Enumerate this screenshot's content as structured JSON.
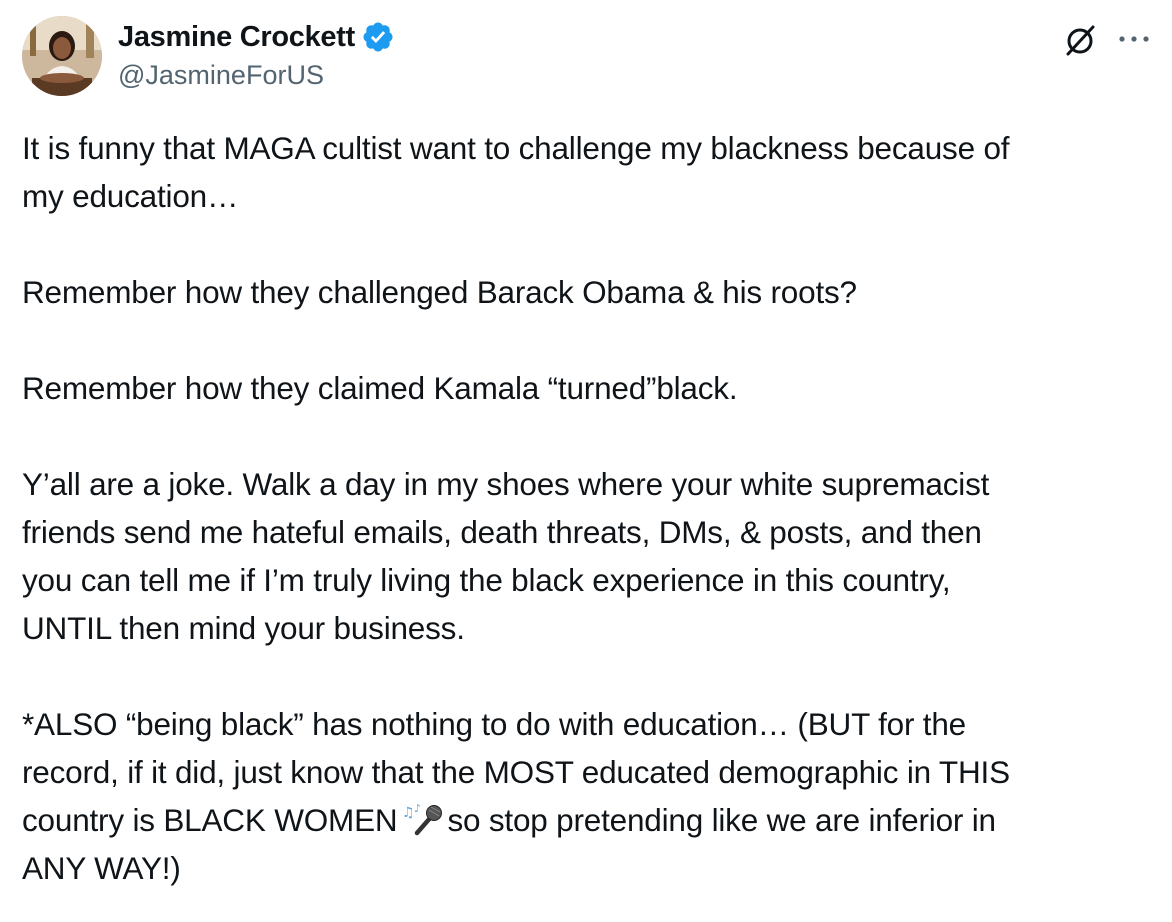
{
  "author": {
    "display_name": "Jasmine Crockett",
    "handle": "@JasmineForUS",
    "verified": true,
    "verified_color": "#1d9bf0"
  },
  "icons": {
    "grok": "grok-slash-circle-icon",
    "more": "more-options-icon",
    "avatar": "profile-photo-avatar",
    "emoji": "singer-microphone-emoji"
  },
  "tweet": {
    "paragraphs": [
      {
        "lines": [
          "It is funny that MAGA cultist want to challenge my blackness because of",
          "my education…"
        ]
      },
      {
        "lines": [
          "Remember how they challenged Barack Obama & his roots?"
        ]
      },
      {
        "lines": [
          "Remember how they claimed Kamala “turned”black."
        ]
      },
      {
        "lines": [
          "Y’all are a joke. Walk a day in my shoes where your white supremacist",
          "friends send me hateful emails, death threats, DMs, & posts, and then",
          "you can tell me if I’m truly living the black experience in this country,",
          "UNTIL then mind your business."
        ]
      },
      {
        "lines": [
          "*ALSO “being black” has nothing to do with education… (BUT for the",
          "record, if it did, just know that the MOST educated demographic in THIS",
          "country is BLACK WOMEN",
          "ANY WAY!)"
        ],
        "line3_after_emoji": "so stop pretending like we are inferior in"
      }
    ]
  },
  "colors": {
    "text": "#0f1419",
    "secondary": "#536471",
    "accent": "#1d9bf0"
  }
}
